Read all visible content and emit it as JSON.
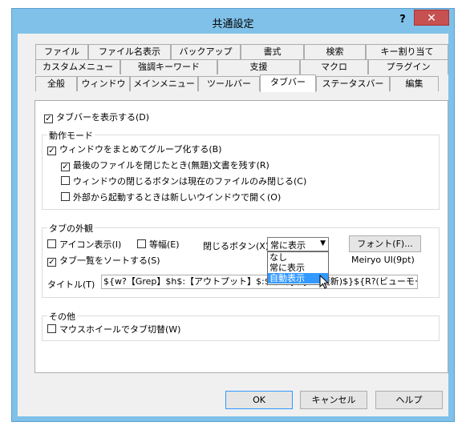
{
  "window": {
    "title": "共通設定",
    "help": "?",
    "close": "✕"
  },
  "tabs": {
    "row1": [
      "ファイル",
      "ファイル名表示",
      "バックアップ",
      "書式",
      "検索",
      "キー割り当て"
    ],
    "row2": [
      "カスタムメニュー",
      "強調キーワード",
      "支援",
      "マクロ",
      "プラグイン"
    ],
    "row3": [
      "全般",
      "ウィンドウ",
      "メインメニュー",
      "ツールバー",
      "タブバー",
      "ステータスバー",
      "編集"
    ],
    "selected": "タブバー"
  },
  "show_tabbar": {
    "label": "タブバーを表示する(D)",
    "checked": true
  },
  "behavior": {
    "legend": "動作モード",
    "group_windows": {
      "label": "ウィンドウをまとめてグループ化する(B)",
      "checked": true
    },
    "keep_last": {
      "label": "最後のファイルを閉じたとき(無題)文書を残す(R)",
      "checked": true
    },
    "close_current": {
      "label": "ウィンドウの閉じるボタンは現在のファイルのみ閉じる(C)",
      "checked": false
    },
    "external_new": {
      "label": "外部から起動するときは新しいウインドウで開く(O)",
      "checked": false
    }
  },
  "appearance": {
    "legend": "タブの外観",
    "icon_display": {
      "label": "アイコン表示(I)",
      "checked": false
    },
    "equal_width": {
      "label": "等幅(E)",
      "checked": false
    },
    "close_button_label": "閉じるボタン(X)",
    "close_button_value": "常に表示",
    "close_button_options": [
      "なし",
      "常に表示",
      "自動表示"
    ],
    "highlighted_option": "自動表示",
    "font_button": "フォント(F)...",
    "font_name": "Meiryo UI(9pt)",
    "sort_tabs": {
      "label": "タブ一覧をソートする(S)",
      "checked": true
    },
    "title_label": "タイトル(T)",
    "title_value": "${w?【Grep】$h$:【アウトプット】$:$f$n$}${U?(更新)$}${R?(ビューモード)$:(上書き"
  },
  "other": {
    "legend": "その他",
    "wheel_switch": {
      "label": "マウスホイールでタブ切替(W)",
      "checked": false
    }
  },
  "buttons": {
    "ok": "OK",
    "cancel": "キャンセル",
    "help": "ヘルプ"
  },
  "check_mark": "✓"
}
